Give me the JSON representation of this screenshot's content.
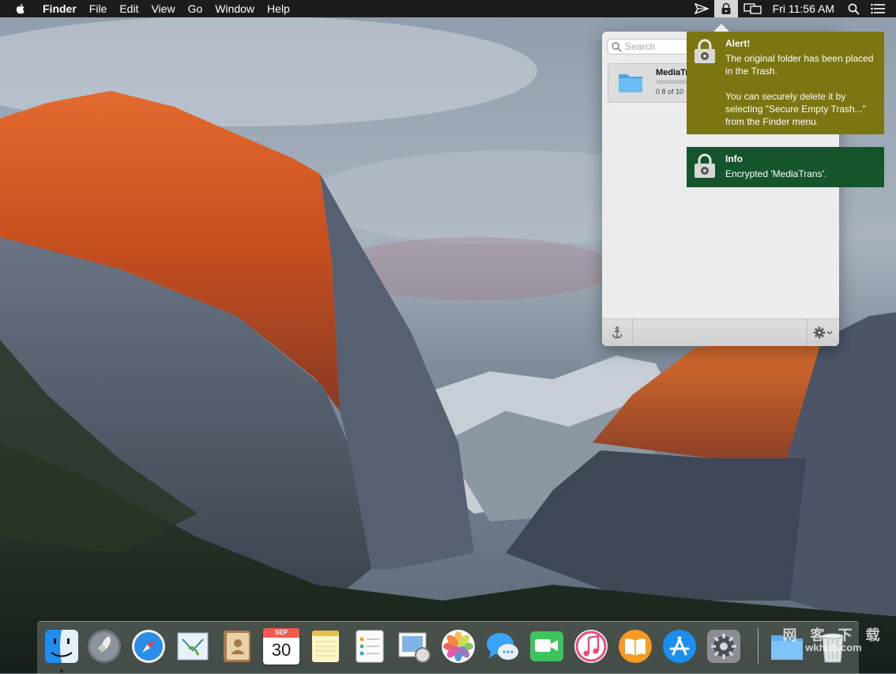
{
  "menubar": {
    "apple_icon": "apple-logo-icon",
    "app_name": "Finder",
    "menus": [
      "File",
      "Edit",
      "View",
      "Go",
      "Window",
      "Help"
    ],
    "status_icons": [
      "paper-plane-icon",
      "lock-icon",
      "display-icon"
    ],
    "clock": "Fri 11:56 AM",
    "spotlight_icon": "search-icon",
    "notification_center_icon": "list-icon"
  },
  "popover": {
    "search": {
      "placeholder": "Search",
      "value": ""
    },
    "file": {
      "name": "MediaTrans",
      "size_text": "0 8 of 10",
      "icon": "folder-icon"
    },
    "footer": {
      "anchor_icon": "anchor-icon",
      "gear_icon": "gear-icon"
    }
  },
  "notifications": [
    {
      "type": "alert",
      "title": "Alert!",
      "message": "The original folder has been placed in the Trash.\n\nYou can securely delete it by selecting \"Secure Empty Trash...\" from the Finder menu.",
      "color": "#7b7512"
    },
    {
      "type": "info",
      "title": "Info",
      "message": "Encrypted 'MediaTrans'.",
      "color": "#15552c"
    }
  ],
  "dock": {
    "apps": [
      "finder-icon",
      "launchpad-icon",
      "safari-icon",
      "mail-icon",
      "contacts-icon",
      "calendar-icon",
      "notes-icon",
      "reminders-icon",
      "preview-icon",
      "photos-icon",
      "messages-icon",
      "facetime-icon",
      "itunes-icon",
      "ibooks-icon",
      "app-store-icon",
      "system-preferences-icon"
    ],
    "calendar_month": "SEP",
    "calendar_day": "30",
    "trailing": [
      "downloads-folder-icon",
      "trash-icon"
    ]
  },
  "watermark": {
    "line1": "网 客 下 载",
    "line2": "wkhub.com"
  }
}
